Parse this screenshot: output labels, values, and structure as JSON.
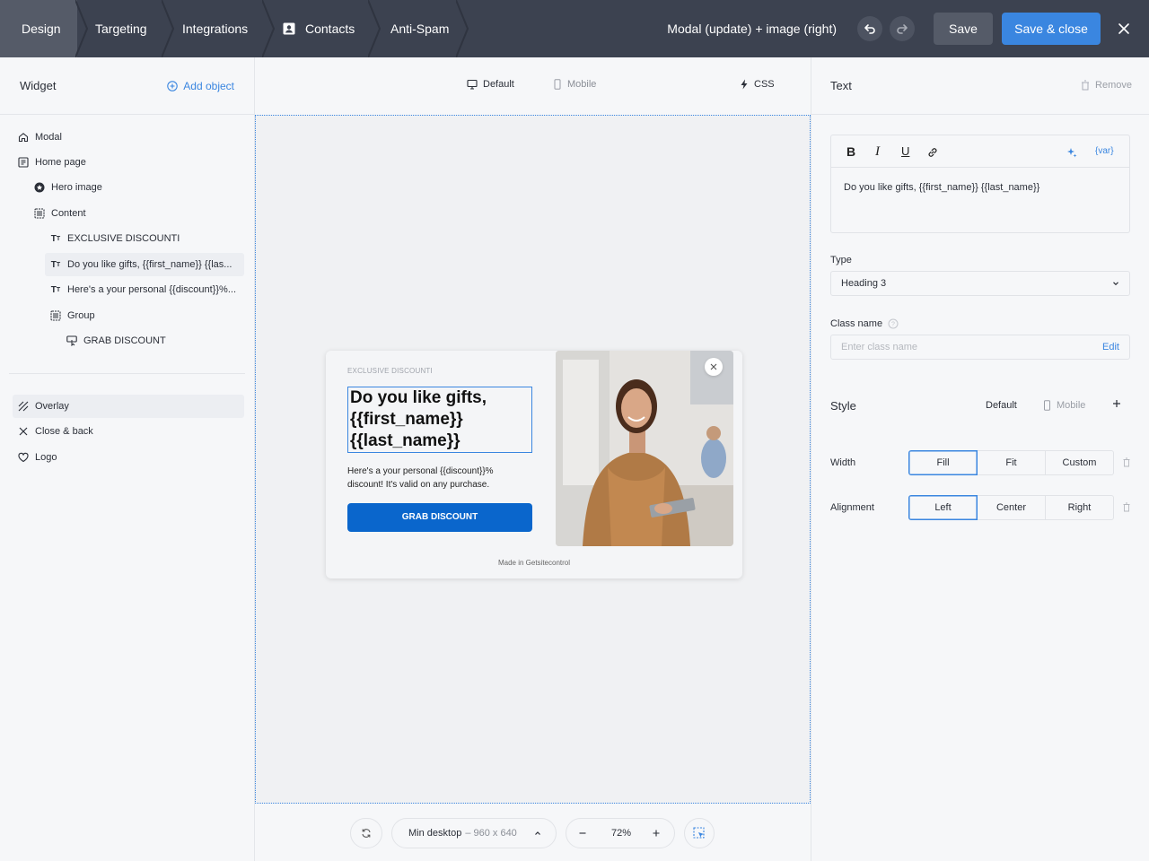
{
  "topbar": {
    "tabs": [
      {
        "label": "Design"
      },
      {
        "label": "Targeting"
      },
      {
        "label": "Integrations"
      },
      {
        "label": "Contacts"
      },
      {
        "label": "Anti-Spam"
      }
    ],
    "title": "Modal (update) + image (right)",
    "save_label": "Save",
    "save_close_label": "Save & close",
    "colors": {
      "bar": "#3c4250",
      "active_tab": "#555b68",
      "accent": "#3a86e0"
    }
  },
  "left": {
    "title": "Widget",
    "add_label": "Add object",
    "tree": [
      {
        "label": "Modal",
        "icon": "home-icon"
      },
      {
        "label": "Home page",
        "icon": "page-icon"
      },
      {
        "label": "Hero image",
        "icon": "image-circle-icon"
      },
      {
        "label": "Content",
        "icon": "layout-icon"
      },
      {
        "label": "EXCLUSIVE DISCOUNTI",
        "icon": "text-type-icon"
      },
      {
        "label": "Do you like gifts, {{first_name}} {{las...",
        "icon": "text-type-icon"
      },
      {
        "label": "Here's a your personal {{discount}}%...",
        "icon": "text-type-icon"
      },
      {
        "label": "Group",
        "icon": "layout-icon"
      },
      {
        "label": "GRAB DISCOUNT",
        "icon": "button-pointer-icon"
      }
    ],
    "extras": [
      {
        "label": "Overlay",
        "icon": "hatch-icon"
      },
      {
        "label": "Close & back",
        "icon": "close-icon"
      },
      {
        "label": "Logo",
        "icon": "heart-icon"
      }
    ]
  },
  "center": {
    "view_default": "Default",
    "view_mobile": "Mobile",
    "css_label": "CSS",
    "modal": {
      "tag": "EXCLUSIVE DISCOUNTI",
      "heading": "Do you like gifts,\n{{first_name}}\n{{last_name}}",
      "text": "Here's a your personal {{discount}}% discount! It's valid on any purchase.",
      "button": "GRAB DISCOUNT",
      "footer": "Made in Getsitecontrol"
    },
    "bottom": {
      "viewport_label": "Min desktop",
      "viewport_size": "– 960 x 640",
      "zoom": "72%"
    }
  },
  "right": {
    "title": "Text",
    "remove_label": "Remove",
    "editor_bold": "B",
    "editor_italic": "I",
    "editor_underline": "U",
    "editor_var": "{var}",
    "editor_text": "Do you like gifts, {{first_name}} {{last_name}}",
    "type_label": "Type",
    "type_value": "Heading 3",
    "class_label": "Class name",
    "class_placeholder": "Enter class name",
    "class_edit": "Edit",
    "style_label": "Style",
    "style_default": "Default",
    "style_mobile": "Mobile",
    "width_label": "Width",
    "width_options": [
      "Fill",
      "Fit",
      "Custom"
    ],
    "width_selected": "Fill",
    "align_label": "Alignment",
    "align_options": [
      "Left",
      "Center",
      "Right"
    ],
    "align_selected": "Left"
  }
}
